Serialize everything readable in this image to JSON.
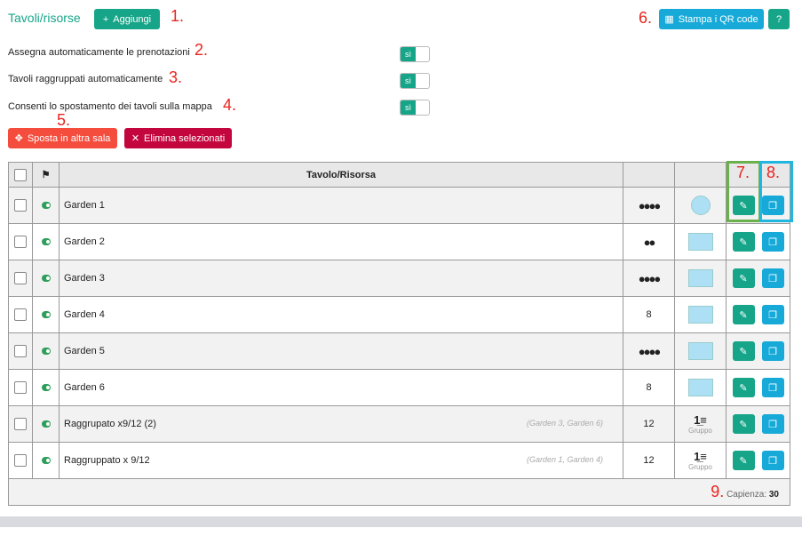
{
  "header": {
    "title": "Tavoli/risorse",
    "add_label": "Aggiungi",
    "qr_label": "Stampa i QR code",
    "help_label": "?"
  },
  "settings": [
    {
      "label": "Assegna automaticamente le prenotazioni",
      "value": "sì"
    },
    {
      "label": "Tavoli raggruppati automaticamente",
      "value": "sì"
    },
    {
      "label": "Consenti lo spostamento dei tavoli sulla mappa",
      "value": "sì"
    }
  ],
  "actions": {
    "move_label": "Sposta in altra sala",
    "delete_label": "Elimina selezionati"
  },
  "annotations": [
    "1.",
    "2.",
    "3.",
    "4.",
    "5.",
    "6.",
    "7.",
    "8.",
    "9."
  ],
  "table": {
    "header": "Tavolo/Risorsa",
    "rows": [
      {
        "name": "Garden 1",
        "group": "",
        "capacity": "●●●●",
        "shape": "round"
      },
      {
        "name": "Garden 2",
        "group": "",
        "capacity": "●●",
        "shape": "rect"
      },
      {
        "name": "Garden 3",
        "group": "",
        "capacity": "●●●●",
        "shape": "rect"
      },
      {
        "name": "Garden 4",
        "group": "",
        "capacity": "8",
        "shape": "rect"
      },
      {
        "name": "Garden 5",
        "group": "",
        "capacity": "●●●●",
        "shape": "rect"
      },
      {
        "name": "Garden 6",
        "group": "",
        "capacity": "8",
        "shape": "rect"
      },
      {
        "name": "Raggrupato x9/12 (2)",
        "group": "(Garden 3, Garden 6)",
        "capacity": "12",
        "shape": "group"
      },
      {
        "name": "Raggruppato x 9/12",
        "group": "(Garden 1, Garden 4)",
        "capacity": "12",
        "shape": "group"
      }
    ],
    "group_label": "Gruppo",
    "footer_label": "Capienza:",
    "footer_value": "30"
  },
  "colors": {
    "primary": "#17a589",
    "info": "#17aad8",
    "danger": "#f44c3d",
    "crimson": "#c4063f"
  }
}
